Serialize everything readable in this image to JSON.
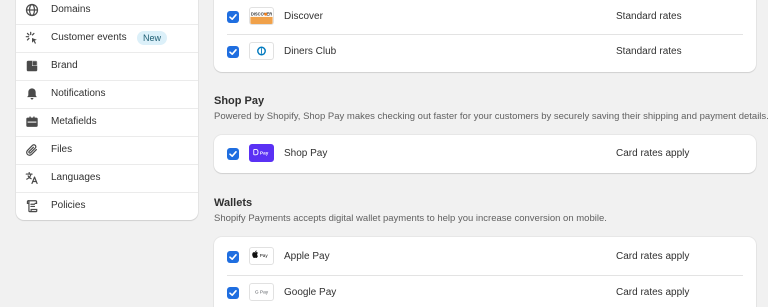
{
  "sidebar": {
    "items": [
      {
        "icon": "globe-icon",
        "label": "Domains"
      },
      {
        "icon": "cursor-click-icon",
        "label": "Customer events",
        "badge": "New"
      },
      {
        "icon": "brand-kit-icon",
        "label": "Brand"
      },
      {
        "icon": "bell-icon",
        "label": "Notifications"
      },
      {
        "icon": "metafields-icon",
        "label": "Metafields"
      },
      {
        "icon": "paperclip-icon",
        "label": "Files"
      },
      {
        "icon": "translate-icon",
        "label": "Languages"
      },
      {
        "icon": "policy-document-icon",
        "label": "Policies"
      }
    ]
  },
  "cards_section": {
    "rows": [
      {
        "name": "Discover",
        "rate": "Standard rates",
        "checked": true,
        "logo_text": "DISCOVER"
      },
      {
        "name": "Diners Club",
        "rate": "Standard rates",
        "checked": true
      }
    ]
  },
  "shop_pay": {
    "title": "Shop Pay",
    "description": "Powered by Shopify, Shop Pay makes checking out faster for your customers by securely saving their shipping and payment details.",
    "rows": [
      {
        "name": "Shop Pay",
        "rate": "Card rates apply",
        "checked": true,
        "logo_text": "Pay"
      }
    ]
  },
  "wallets": {
    "title": "Wallets",
    "description": "Shopify Payments accepts digital wallet payments to help you increase conversion on mobile.",
    "rows": [
      {
        "name": "Apple Pay",
        "rate": "Card rates apply",
        "checked": true,
        "logo_text": "Pay"
      },
      {
        "name": "Google Pay",
        "rate": "Card rates apply",
        "checked": true,
        "logo_text": "G Pay"
      }
    ]
  },
  "colors": {
    "accent_checkbox": "#1f6ee0",
    "shop_pay_purple": "#5a31f4",
    "badge_bg": "#dcf0f9"
  }
}
